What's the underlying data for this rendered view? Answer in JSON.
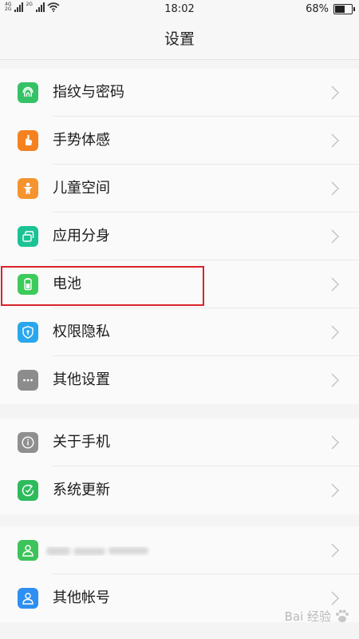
{
  "status": {
    "net_top": "4G",
    "net_bottom": "2G",
    "time": "18:02",
    "battery_pct": "68%",
    "battery_level": 0.68
  },
  "header": {
    "title": "设置"
  },
  "groups": [
    {
      "items": [
        {
          "label": "指纹与密码",
          "icon": "fingerprint-icon",
          "color": "#35c266"
        },
        {
          "label": "手势体感",
          "icon": "gesture-icon",
          "color": "#f5821f"
        },
        {
          "label": "儿童空间",
          "icon": "child-icon",
          "color": "#f5932f"
        },
        {
          "label": "应用分身",
          "icon": "clone-icon",
          "color": "#1bc294"
        },
        {
          "label": "电池",
          "icon": "battery-icon",
          "color": "#3ccb5b"
        },
        {
          "label": "权限隐私",
          "icon": "shield-icon",
          "color": "#2aa7ec"
        },
        {
          "label": "其他设置",
          "icon": "more-icon",
          "color": "#8c8c8c"
        }
      ]
    },
    {
      "items": [
        {
          "label": "关于手机",
          "icon": "info-icon",
          "color": "#8f8f8f"
        },
        {
          "label": "系统更新",
          "icon": "update-icon",
          "color": "#2dbb5c"
        }
      ]
    },
    {
      "items": [
        {
          "label": "",
          "icon": "user-icon",
          "color": "#3ec35b"
        },
        {
          "label": "其他帐号",
          "icon": "user-icon",
          "color": "#2e8ff0"
        }
      ]
    }
  ],
  "watermark": {
    "text": "Bai 经验"
  }
}
